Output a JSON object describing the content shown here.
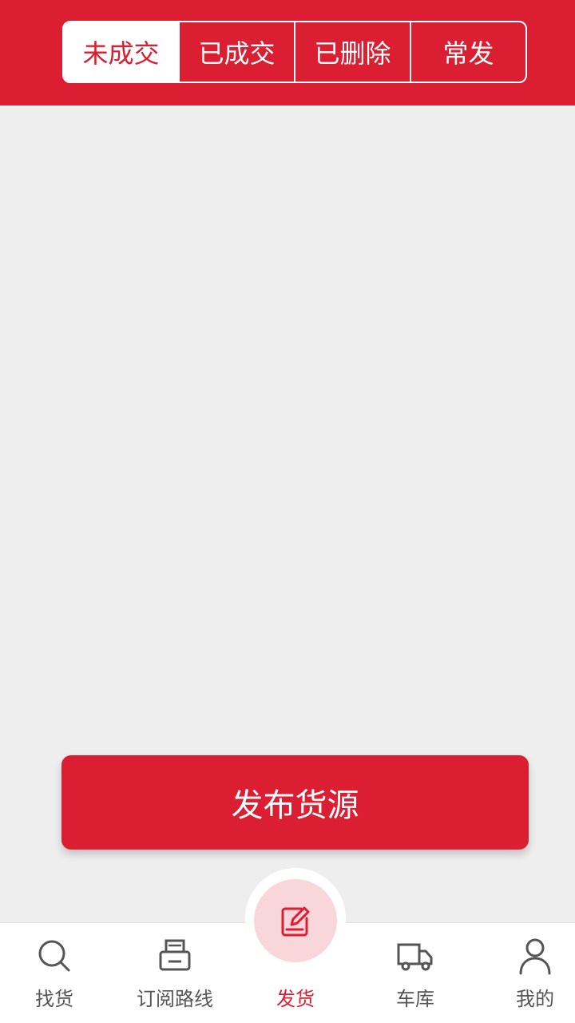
{
  "header": {
    "tabs": [
      {
        "label": "未成交",
        "active": true
      },
      {
        "label": "已成交",
        "active": false
      },
      {
        "label": "已删除",
        "active": false
      },
      {
        "label": "常发",
        "active": false
      }
    ]
  },
  "main": {
    "publish_button_label": "发布货源"
  },
  "bottom_nav": {
    "items": [
      {
        "label": "找货",
        "icon": "search-icon",
        "active": false
      },
      {
        "label": "订阅路线",
        "icon": "printer-icon",
        "active": false
      },
      {
        "label": "发货",
        "icon": "edit-icon",
        "active": true
      },
      {
        "label": "车库",
        "icon": "truck-icon",
        "active": false
      },
      {
        "label": "我的",
        "icon": "user-icon",
        "active": false
      }
    ]
  },
  "colors": {
    "brand": "#db1e32",
    "background": "#eeeeee",
    "center_tint": "#f8d6da",
    "inactive_text": "#555555"
  }
}
